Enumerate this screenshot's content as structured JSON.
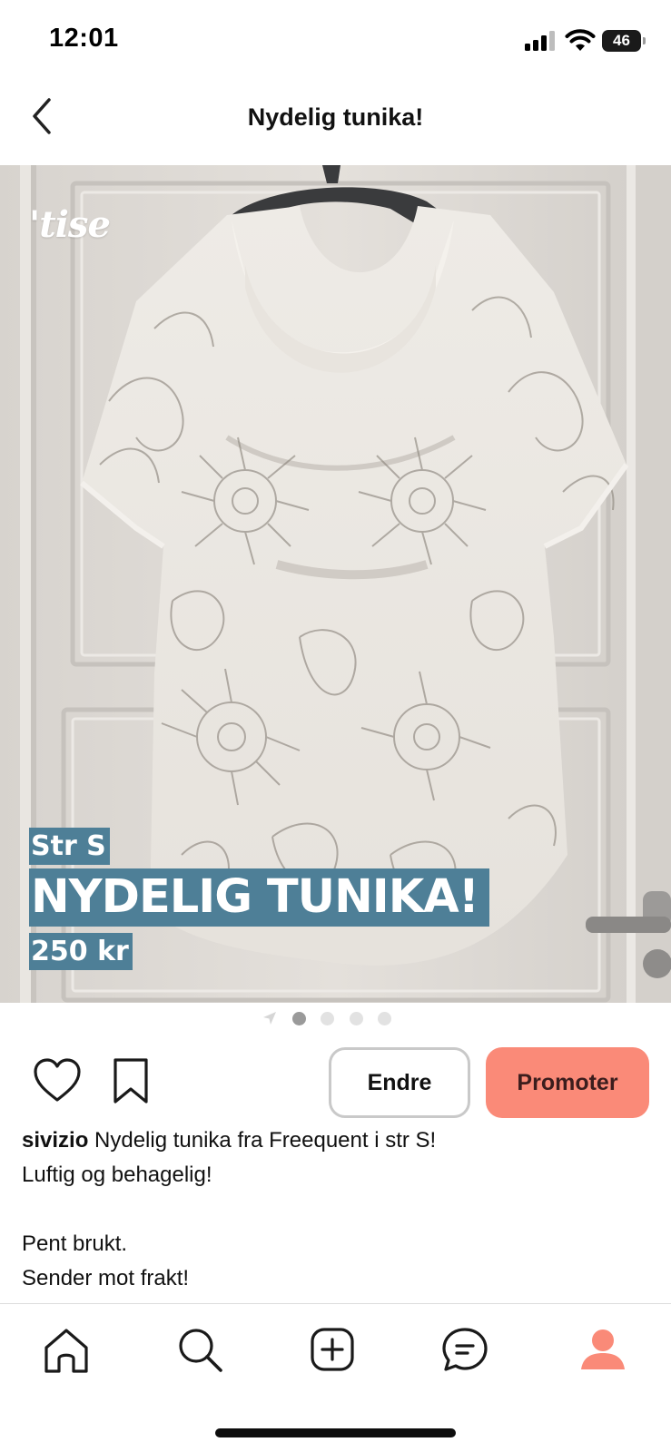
{
  "status_bar": {
    "time": "12:01",
    "battery_level": "46"
  },
  "header": {
    "title": "Nydelig tunika!",
    "back_icon": "chevron-left-icon"
  },
  "image": {
    "watermark": "'tise",
    "overlay_size": "Str S",
    "overlay_title": "NYDELIG TUNIKA!",
    "overlay_price": "250 kr",
    "overlay_color": "#4e7f97"
  },
  "carousel": {
    "count": 4,
    "active_index": 0
  },
  "actions": {
    "like_icon": "heart-icon",
    "save_icon": "bookmark-icon",
    "edit_label": "Endre",
    "promote_label": "Promoter",
    "promote_color": "#fa8a78"
  },
  "description": {
    "username": "sivizio",
    "line1": " Nydelig tunika fra Freequent i str S!",
    "line2": "Luftig og behagelig!",
    "line3": "Pent brukt.",
    "line4": "Sender mot frakt!"
  },
  "tab_bar": {
    "items": [
      {
        "icon": "home-icon"
      },
      {
        "icon": "search-icon"
      },
      {
        "icon": "add-icon"
      },
      {
        "icon": "chat-icon"
      },
      {
        "icon": "profile-icon",
        "active": true
      }
    ],
    "accent": "#fa8a78"
  }
}
